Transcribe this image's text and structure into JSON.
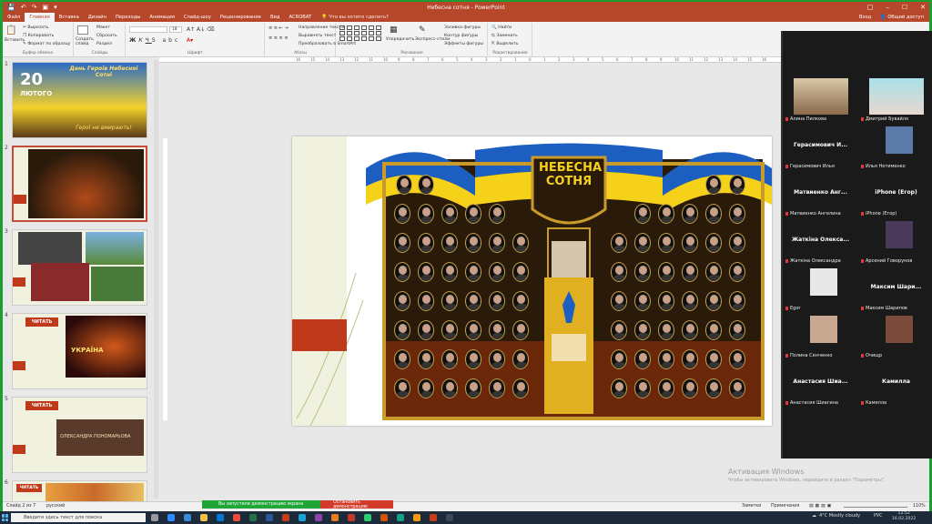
{
  "window": {
    "title": "Небесна сотня - PowerPoint",
    "signin": "Вход",
    "share": "Общий доступ"
  },
  "tabs": [
    {
      "label": "Файл"
    },
    {
      "label": "Главная"
    },
    {
      "label": "Вставка"
    },
    {
      "label": "Дизайн"
    },
    {
      "label": "Переходы"
    },
    {
      "label": "Анимация"
    },
    {
      "label": "Слайд-шоу"
    },
    {
      "label": "Рецензирование"
    },
    {
      "label": "Вид"
    },
    {
      "label": "ACROBAT"
    }
  ],
  "tell_me": "Что вы хотите сделать?",
  "ribbon": {
    "clipboard": {
      "paste": "Вставить",
      "cut": "Вырезать",
      "copy": "Копировать",
      "format_painter": "Формат по образцу",
      "label": "Буфер обмена"
    },
    "slides": {
      "new_slide": "Создать слайд",
      "layout": "Макет",
      "reset": "Сбросить",
      "section": "Раздел",
      "label": "Слайды"
    },
    "font": {
      "label": "Шрифт",
      "size": "18"
    },
    "paragraph": {
      "label": "Абзац",
      "direction": "Направление текста",
      "align": "Выровнять текст",
      "smartart": "Преобразовать в SmartArt"
    },
    "drawing": {
      "label": "Рисование",
      "arrange": "Упорядочить",
      "quick_styles": "Экспресс-стили",
      "fill": "Заливка фигуры",
      "outline": "Контур фигуры",
      "effects": "Эффекты фигуры"
    },
    "editing": {
      "label": "Редактирование",
      "find": "Найти",
      "replace": "Заменить",
      "select": "Выделить"
    }
  },
  "ruler_ticks": [
    "16",
    "15",
    "14",
    "13",
    "12",
    "11",
    "10",
    "9",
    "8",
    "7",
    "6",
    "5",
    "4",
    "3",
    "2",
    "1",
    "0",
    "1",
    "2",
    "3",
    "4",
    "5",
    "6",
    "7",
    "8",
    "9",
    "10",
    "11",
    "12",
    "13",
    "14",
    "15",
    "16"
  ],
  "thumbnails": [
    {
      "num": "1",
      "big": "20",
      "month": "лютого",
      "caption": "День Героїв Небесної Сотні",
      "footer": "Герої не вмирають!"
    },
    {
      "num": "2"
    },
    {
      "num": "3"
    },
    {
      "num": "4",
      "button": "ЧИТАТЬ",
      "word": "УКРАЇНА"
    },
    {
      "num": "5",
      "button": "ЧИТАТЬ",
      "name": "ОЛЕКСАНДРА ПОНОМАРЬОВА"
    },
    {
      "num": "6",
      "button": "ЧИТАТЬ"
    }
  ],
  "poster": {
    "title_line1": "НЕБЕСНА",
    "title_line2": "СОТНЯ",
    "colors": {
      "blue": "#1c5fc0",
      "yellow": "#f5d11a",
      "gold": "#c89b2a",
      "olive": "#8a6f3a"
    }
  },
  "status": {
    "slide": "Слайд 2 из 7",
    "language": "русский",
    "notes": "Заметки",
    "comments": "Примечания",
    "zoom": "110%"
  },
  "sharing": {
    "running": "Вы запустили демонстрацию экрана",
    "stop": "Остановить демонстрацию"
  },
  "activation": {
    "title": "Активация Windows",
    "subtitle": "Чтобы активировать Windows, перейдите в раздел \"Параметры\"."
  },
  "participants": [
    {
      "big": "",
      "label": "Алина Пилкова",
      "video": true
    },
    {
      "big": "",
      "label": "Дмитрий Бувайло",
      "video": true
    },
    {
      "big": "Герасимович И...",
      "label": "Герасимович Илья"
    },
    {
      "big": "",
      "label": "Илья Нетименко",
      "avatar": true
    },
    {
      "big": "Матвиенко Анг...",
      "label": "Матвиенко Ангелина"
    },
    {
      "big": "iPhone (Егор)",
      "label": "iPhone (Егор)"
    },
    {
      "big": "Жаткіна Олекса...",
      "label": "Жаткіна Олександра"
    },
    {
      "big": "",
      "label": "Арсений Говорунов",
      "avatar": true
    },
    {
      "big": "",
      "label": "Egor",
      "avatar": true
    },
    {
      "big": "Максим Шари...",
      "label": "Максим Шарипов"
    },
    {
      "big": "",
      "label": "Полина Сенченко",
      "avatar": true
    },
    {
      "big": "",
      "label": "Очищр",
      "avatar": true
    },
    {
      "big": "Анастасия Шиа...",
      "label": "Анастасия Шиагина"
    },
    {
      "big": "Камилла",
      "label": "Камилла"
    }
  ],
  "taskbar": {
    "search": "Введите здесь текст для поиска",
    "weather": "4°C Mostly cloudy",
    "lang": "РУС",
    "time": "12:52",
    "date": "16.02.2022"
  }
}
